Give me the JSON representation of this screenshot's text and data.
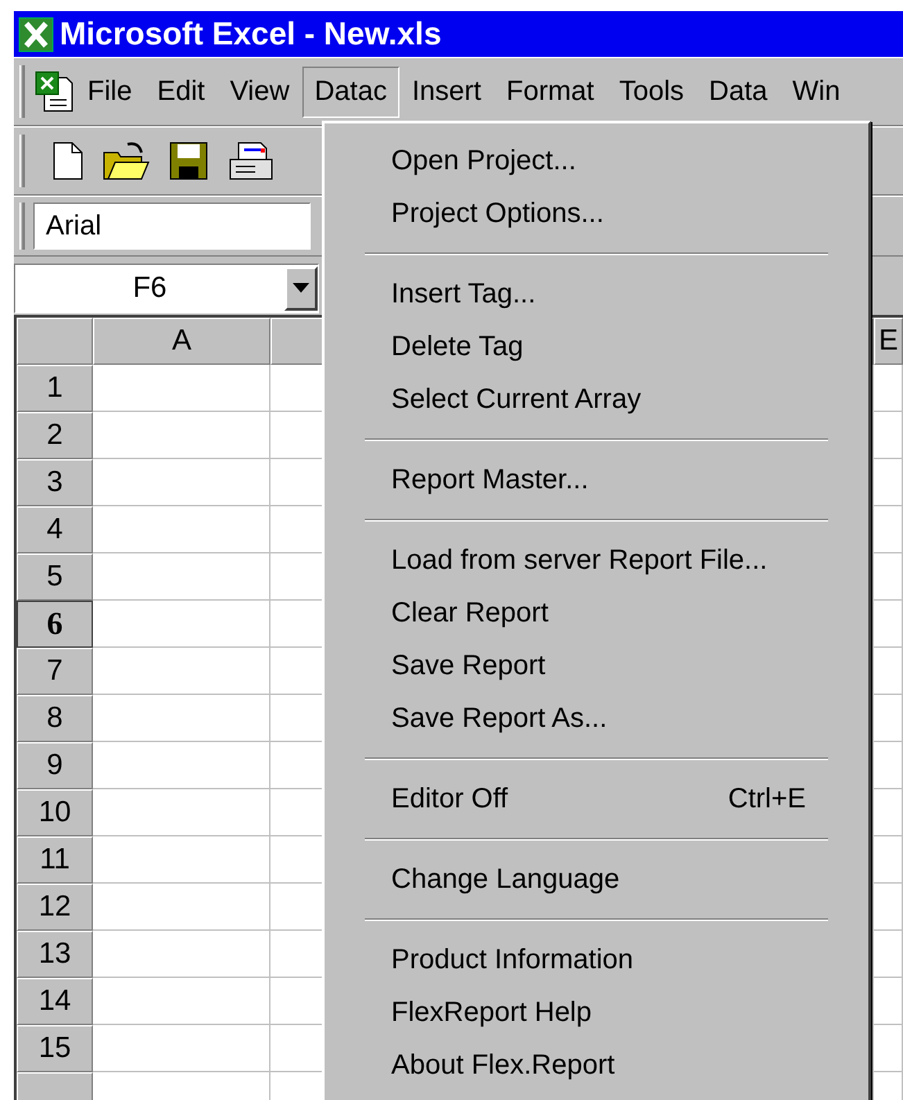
{
  "window": {
    "title": "Microsoft Excel - New.xls"
  },
  "menu_bar": [
    {
      "label": "File",
      "selected": false
    },
    {
      "label": "Edit",
      "selected": false
    },
    {
      "label": "View",
      "selected": false
    },
    {
      "label": "Datac",
      "selected": true
    },
    {
      "label": "Insert",
      "selected": false
    },
    {
      "label": "Format",
      "selected": false
    },
    {
      "label": "Tools",
      "selected": false
    },
    {
      "label": "Data",
      "selected": false
    },
    {
      "label": "Win",
      "selected": false
    }
  ],
  "formatting_bar": {
    "font": "Arial"
  },
  "name_box": {
    "value": "F6"
  },
  "sheet": {
    "columns": [
      {
        "label": "A"
      },
      {},
      {},
      {},
      {
        "label": "E"
      }
    ],
    "rows": [
      {
        "label": "1",
        "selected": false
      },
      {
        "label": "2",
        "selected": false
      },
      {
        "label": "3",
        "selected": false
      },
      {
        "label": "4",
        "selected": false
      },
      {
        "label": "5",
        "selected": false
      },
      {
        "label": "6",
        "selected": true
      },
      {
        "label": "7",
        "selected": false
      },
      {
        "label": "8",
        "selected": false
      },
      {
        "label": "9",
        "selected": false
      },
      {
        "label": "10",
        "selected": false
      },
      {
        "label": "11",
        "selected": false
      },
      {
        "label": "12",
        "selected": false
      },
      {
        "label": "13",
        "selected": false
      },
      {
        "label": "14",
        "selected": false
      },
      {
        "label": "15",
        "selected": false
      },
      {
        "selected": false
      }
    ]
  },
  "dropdown_menu": [
    {
      "kind": "item",
      "label": "Open Project..."
    },
    {
      "kind": "item",
      "label": "Project Options..."
    },
    {
      "kind": "separator"
    },
    {
      "kind": "item",
      "label": "Insert Tag..."
    },
    {
      "kind": "item",
      "label": "Delete Tag"
    },
    {
      "kind": "item",
      "label": "Select Current Array"
    },
    {
      "kind": "separator"
    },
    {
      "kind": "item",
      "label": "Report Master..."
    },
    {
      "kind": "separator"
    },
    {
      "kind": "item",
      "label": "Load from server Report File..."
    },
    {
      "kind": "item",
      "label": "Clear Report"
    },
    {
      "kind": "item",
      "label": "Save Report"
    },
    {
      "kind": "item",
      "label": "Save Report As..."
    },
    {
      "kind": "separator"
    },
    {
      "kind": "item",
      "label": "Editor Off",
      "shortcut": "Ctrl+E"
    },
    {
      "kind": "separator"
    },
    {
      "kind": "item",
      "label": "Change Language"
    },
    {
      "kind": "separator"
    },
    {
      "kind": "item",
      "label": "Product Information"
    },
    {
      "kind": "item",
      "label": "FlexReport Help"
    },
    {
      "kind": "item",
      "label": "About Flex.Report"
    }
  ]
}
